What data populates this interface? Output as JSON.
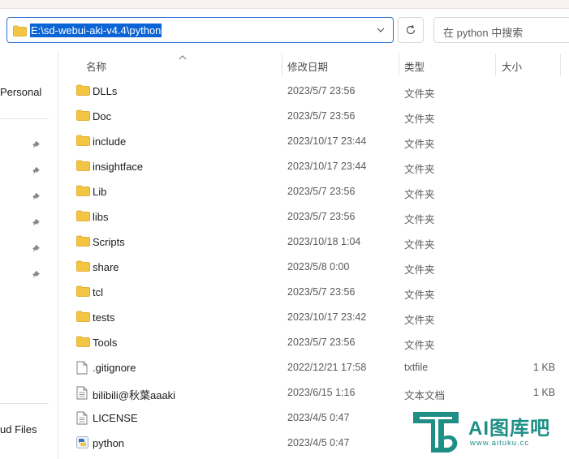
{
  "address_bar": {
    "path": "E:\\sd-webui-aki-v4.4\\python"
  },
  "search": {
    "placeholder": "在 python 中搜索"
  },
  "nav": {
    "personal": "Personal",
    "cloud": "ud Files"
  },
  "columns": {
    "name": "名称",
    "date": "修改日期",
    "type": "类型",
    "size": "大小"
  },
  "files": [
    {
      "name": "DLLs",
      "date": "2023/5/7 23:56",
      "type": "文件夹",
      "size": "",
      "icon": "folder-icon"
    },
    {
      "name": "Doc",
      "date": "2023/5/7 23:56",
      "type": "文件夹",
      "size": "",
      "icon": "folder-icon"
    },
    {
      "name": "include",
      "date": "2023/10/17 23:44",
      "type": "文件夹",
      "size": "",
      "icon": "folder-icon"
    },
    {
      "name": "insightface",
      "date": "2023/10/17 23:44",
      "type": "文件夹",
      "size": "",
      "icon": "folder-icon"
    },
    {
      "name": "Lib",
      "date": "2023/5/7 23:56",
      "type": "文件夹",
      "size": "",
      "icon": "folder-icon"
    },
    {
      "name": "libs",
      "date": "2023/5/7 23:56",
      "type": "文件夹",
      "size": "",
      "icon": "folder-icon"
    },
    {
      "name": "Scripts",
      "date": "2023/10/18 1:04",
      "type": "文件夹",
      "size": "",
      "icon": "folder-icon"
    },
    {
      "name": "share",
      "date": "2023/5/8 0:00",
      "type": "文件夹",
      "size": "",
      "icon": "folder-icon"
    },
    {
      "name": "tcl",
      "date": "2023/5/7 23:56",
      "type": "文件夹",
      "size": "",
      "icon": "folder-icon"
    },
    {
      "name": "tests",
      "date": "2023/10/17 23:42",
      "type": "文件夹",
      "size": "",
      "icon": "folder-icon"
    },
    {
      "name": "Tools",
      "date": "2023/5/7 23:56",
      "type": "文件夹",
      "size": "",
      "icon": "folder-icon"
    },
    {
      "name": ".gitignore",
      "date": "2022/12/21 17:58",
      "type": "txtfile",
      "size": "1 KB",
      "icon": "file-icon"
    },
    {
      "name": "bilibili@秋葉aaaki",
      "date": "2023/6/15 1:16",
      "type": "文本文档",
      "size": "1 KB",
      "icon": "text-file-icon"
    },
    {
      "name": "LICENSE",
      "date": "2023/4/5 0:47",
      "type": "",
      "size": "",
      "icon": "text-file-icon"
    },
    {
      "name": "python",
      "date": "2023/4/5 0:47",
      "type": "",
      "size": "",
      "icon": "python-exe-icon"
    }
  ],
  "watermark": {
    "title": "AI图库吧",
    "url": "www.aituku.cc"
  },
  "colors": {
    "selection": "#0a64d4",
    "folder": "#f4c542",
    "watermark": "#1f8f86"
  }
}
